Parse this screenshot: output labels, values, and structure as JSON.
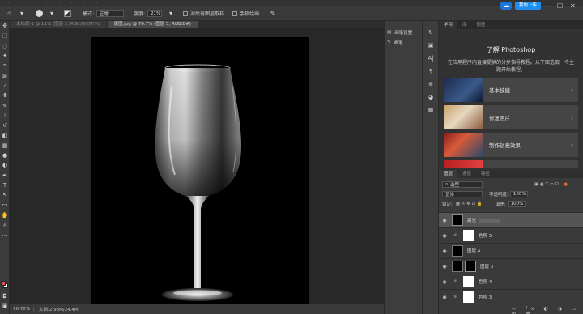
{
  "options_bar": {
    "mode_label": "模式:",
    "mode_value": "正常",
    "strength_label": "强度:",
    "strength_value": "21%",
    "sample_all_label": "对所有图层取样",
    "finger_paint_label": "手指绘画"
  },
  "cloud": {
    "button_label": "我的上传"
  },
  "document_tabs": [
    {
      "label": "未标题-1 @ 11% (图层 2, RGB/8/CMYK)",
      "active": false
    },
    {
      "label": "原图.jpg @ 76.7% (图层 5, RGB/8#)",
      "active": true
    }
  ],
  "status_bar": {
    "zoom": "76.72%",
    "doc_info": "文档:2.93M/24.4M"
  },
  "mid_panel": {
    "brush_settings_label": "画笔设置",
    "brush_label": "画笔"
  },
  "right_panel": {
    "tabs": [
      "学习",
      "库",
      "调整"
    ],
    "learn_title": "了解 Photoshop",
    "learn_desc": "在应用程序内直接提供的分步指导教程。从下面选取一个主题开始教程。",
    "cards": [
      {
        "label": "基本技能"
      },
      {
        "label": "修复照片"
      },
      {
        "label": "制作创意效果"
      },
      {
        "label": ""
      }
    ]
  },
  "layers_panel": {
    "tabs": [
      "图层",
      "通道",
      "路径"
    ],
    "filter_label": "选型",
    "blend_mode": "正常",
    "opacity_label": "不透明度:",
    "opacity_value": "100%",
    "lock_label": "锁定:",
    "fill_label": "填充:",
    "fill_value": "100%",
    "layers": [
      {
        "name": "高光",
        "selected": true
      },
      {
        "name": "色阶 5",
        "selected": false
      },
      {
        "name": "图层 4",
        "selected": false
      },
      {
        "name": "图层 3",
        "selected": false
      },
      {
        "name": "色阶 4",
        "selected": false
      },
      {
        "name": "色阶 3",
        "selected": false
      }
    ]
  },
  "colors": {
    "accent": "#1d8ef0",
    "foreground_swatch": "#e15060",
    "background_swatch": "#ffffff"
  }
}
